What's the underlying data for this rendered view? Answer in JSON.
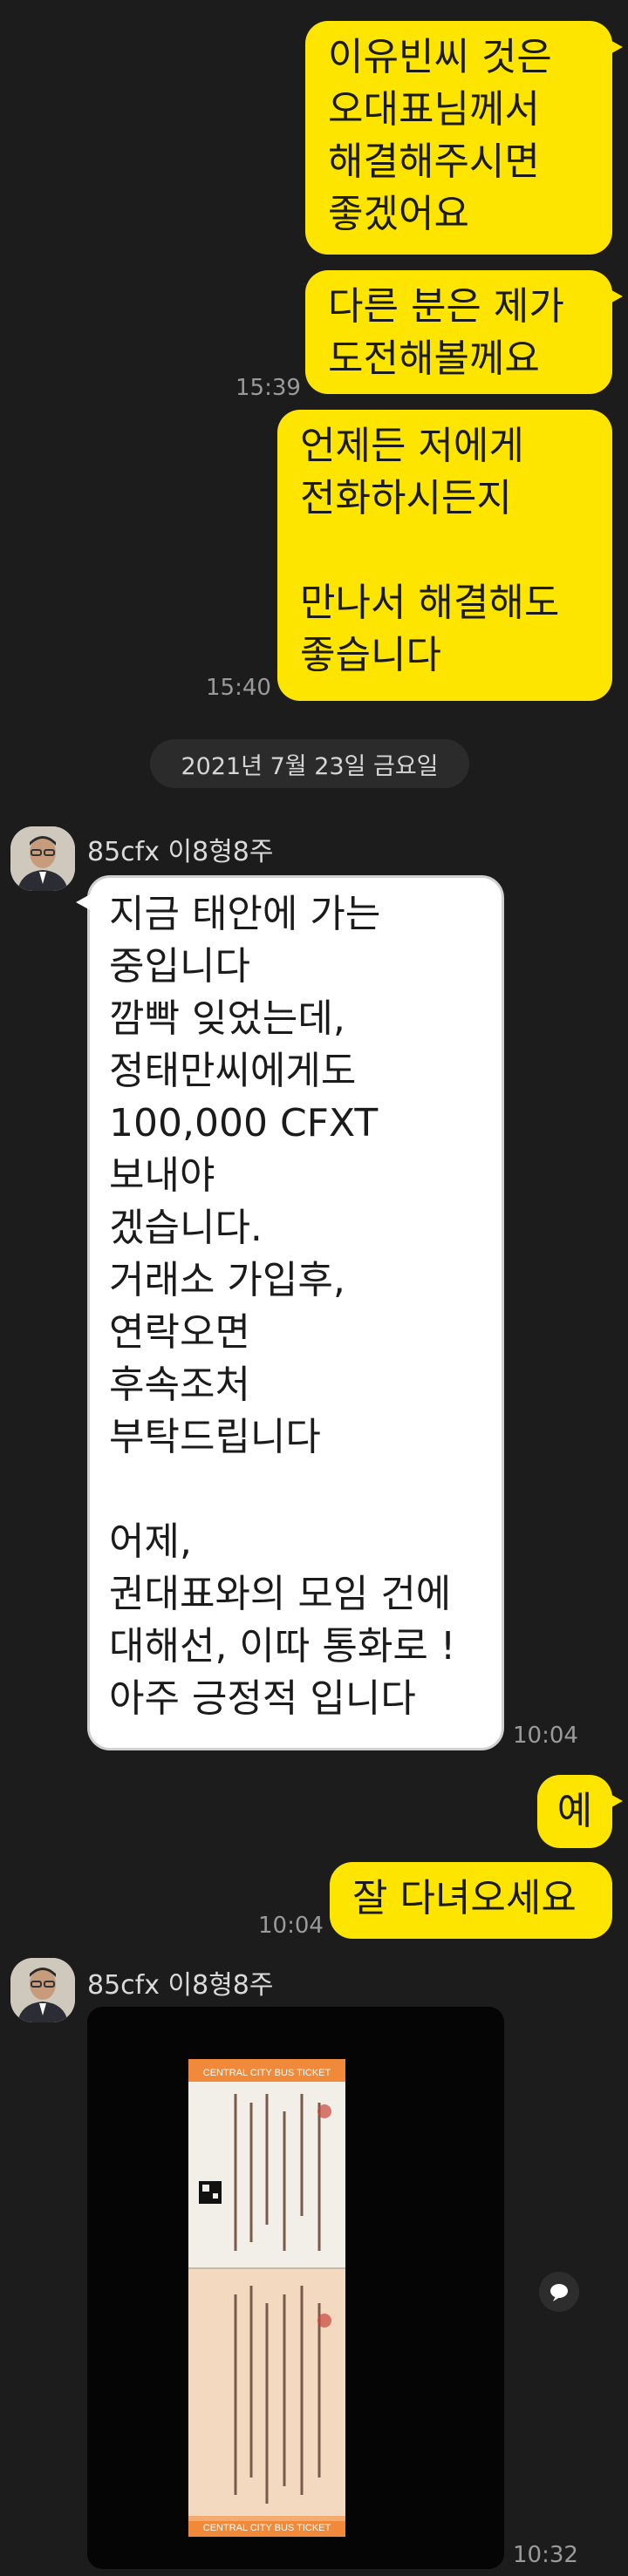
{
  "messages_top": {
    "m1": "이유빈씨 것은\n오대표님께서\n해결해주시면\n좋겠어요",
    "m2": "다른 분은 제가\n도전해볼께요",
    "m2_time": "15:39",
    "m3": "언제든 저에게\n전화하시든지\n\n만나서 해결해도\n좋습니다",
    "m3_time": "15:40"
  },
  "date_divider": "2021년 7월 23일 금요일",
  "sender1": {
    "name": "85cfx 이8형8주"
  },
  "msg_long": "지금 태안에 가는\n중입니다\n깜빡 잊었는데,\n정태만씨에게도\n100,000 CFXT\n보내야\n겠습니다.\n거래소 가입후,\n연락오면\n후속조처\n부탁드립니다\n\n어제,\n권대표와의 모임 건에\n대해선, 이따 통화로 !\n아주 긍정적 입니다",
  "msg_long_time": "10:04",
  "reply1": "예",
  "reply2": "잘 다녀오세요",
  "reply_time": "10:04",
  "sender2": {
    "name": "85cfx 이8형8주"
  },
  "photo": {
    "ticket_top": "CENTRAL CITY BUS TICKET",
    "ticket_bottom": "CENTRAL CITY BUS TICKET"
  },
  "photo_time": "10:32",
  "colors": {
    "background": "#1c1c1c",
    "my_bubble": "#fee500",
    "their_bubble": "#ffffff"
  },
  "icons": {
    "share": "share-icon",
    "avatar": "avatar"
  }
}
